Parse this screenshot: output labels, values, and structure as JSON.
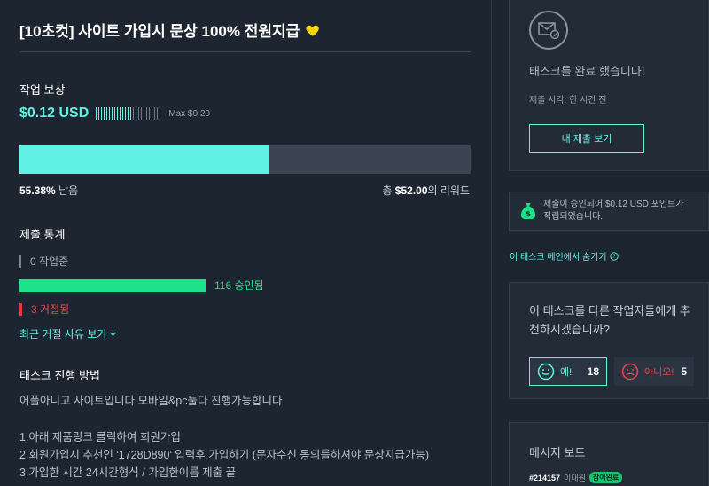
{
  "task": {
    "title": "[10초컷] 사이트 가입시 문상 100% 전원지급"
  },
  "reward": {
    "label": "작업 보상",
    "amount": "$0.12 USD",
    "max": "Max $0.20",
    "ticks_filled_fraction": 0.6
  },
  "progress": {
    "fill_percent": 55.38,
    "remaining_value": "55.38%",
    "remaining_suffix": " 남음",
    "total_prefix": "총 ",
    "total_value": "$52.00",
    "total_suffix": "의 리워드"
  },
  "stats": {
    "label": "제출 통계",
    "working": "0 작업중",
    "approved": "116 승인됨",
    "rejected": "3 거절됨",
    "reason_link": "최근 거절 사유 보기"
  },
  "howto": {
    "label": "태스크 진행 방법",
    "lines": [
      "어플아니고 사이트입니다 모바일&pc둘다 진행가능합니다",
      "1.아래 제품링크 클릭하여 회원가입",
      "2.회원가입시 추천인 '1728D890' 입력후 가입하기 (문자수신 동의를하셔야 문상지급가능)",
      "3.가입한 시간 24시간형식 / 가입한이름 제출 끝"
    ]
  },
  "complete": {
    "text": "태스크를 완료 했습니다!",
    "submit_time": "제출 시각: 한 시간 전",
    "view_button": "내 제출 보기"
  },
  "point_notice": {
    "line1": "제출이 승인되어 $0.12 USD 포인트가",
    "line2": "적립되었습니다."
  },
  "hide_link": "이 태스크 메인에서 숨기기",
  "recommend": {
    "question": "이 태스크를 다른 작업자들에게 추천하시겠습니까?",
    "yes_label": "예!",
    "yes_count": "18",
    "no_label": "아니오!",
    "no_count": "5"
  },
  "board": {
    "title": "메시지 보드",
    "msg_id": "#214157",
    "msg_user": "이대원",
    "badge": "참여완료"
  },
  "colors": {
    "accent": "#5ff3e2",
    "green": "#1de28a",
    "red": "#e3484a",
    "bg": "#1d2530"
  }
}
